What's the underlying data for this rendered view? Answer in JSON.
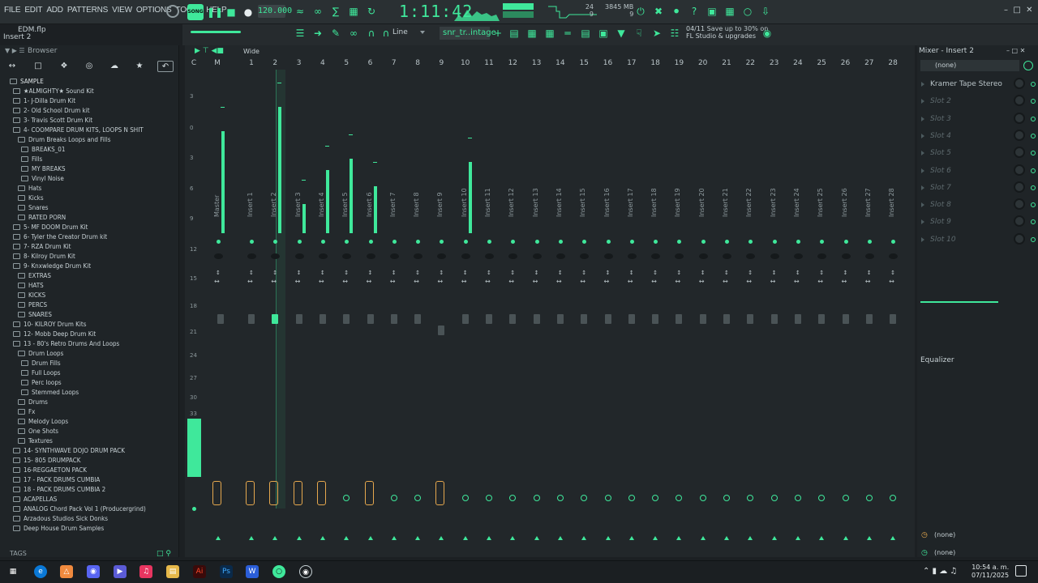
{
  "menu": [
    "FILE",
    "EDIT",
    "ADD",
    "PATTERNS",
    "VIEW",
    "OPTIONS",
    "TOOLS",
    "HELP"
  ],
  "project": {
    "file": "EDM.flp",
    "focus": "Insert 2"
  },
  "transport": {
    "mode": "SONG",
    "bpm": "120.000",
    "time": "1:11:42"
  },
  "memory": {
    "value": "3845 MB",
    "cpu": "9"
  },
  "cpu_meter": {
    "top": "24",
    "bottom": "9"
  },
  "toolbar": {
    "snap": "Line",
    "pattern": "snr_tr..intage",
    "mode": "Wide"
  },
  "promo": {
    "count": "04/11",
    "line1": "Save up to 30% on",
    "line2": "FL Studio & upgrades"
  },
  "browser": {
    "title": "Browser",
    "root": "SAMPLE",
    "items": [
      {
        "label": "★ALMIGHTY★ Sound Kit",
        "indent": 1
      },
      {
        "label": "1- J-Dilla Drum Kit",
        "indent": 1
      },
      {
        "label": "2- Old School Drum kit",
        "indent": 1
      },
      {
        "label": "3- Travis Scott Drum Kit",
        "indent": 1
      },
      {
        "label": "4- COOMPARE DRUM KITS, LOOPS N SHIT",
        "indent": 1
      },
      {
        "label": "Drum Breaks Loops and Fills",
        "indent": 2
      },
      {
        "label": "BREAKS_01",
        "indent": 3
      },
      {
        "label": "Fills",
        "indent": 3
      },
      {
        "label": "MY BREAKS",
        "indent": 3
      },
      {
        "label": "Vinyl Noise",
        "indent": 3
      },
      {
        "label": "Hats",
        "indent": 2
      },
      {
        "label": "Kicks",
        "indent": 2
      },
      {
        "label": "Snares",
        "indent": 2
      },
      {
        "label": "RATED PORN",
        "indent": 2
      },
      {
        "label": "5- MF DOOM Drum Kit",
        "indent": 1
      },
      {
        "label": "6- Tyler the Creator Drum kit",
        "indent": 1
      },
      {
        "label": "7- RZA Drum Kit",
        "indent": 1
      },
      {
        "label": "8- Kilroy Drum Kit",
        "indent": 1
      },
      {
        "label": "9- Knxwledge Drum Kit",
        "indent": 1
      },
      {
        "label": "EXTRAS",
        "indent": 2
      },
      {
        "label": "HATS",
        "indent": 2
      },
      {
        "label": "KICKS",
        "indent": 2
      },
      {
        "label": "PERCS",
        "indent": 2
      },
      {
        "label": "SNARES",
        "indent": 2
      },
      {
        "label": "10- KILROY Drum Kits",
        "indent": 1
      },
      {
        "label": "12- Mobb Deep Drum Kit",
        "indent": 1
      },
      {
        "label": "13 - 80's Retro Drums And Loops",
        "indent": 1
      },
      {
        "label": "Drum Loops",
        "indent": 2
      },
      {
        "label": "Drum Fills",
        "indent": 3
      },
      {
        "label": "Full Loops",
        "indent": 3
      },
      {
        "label": "Perc loops",
        "indent": 3
      },
      {
        "label": "Stemmed Loops",
        "indent": 3
      },
      {
        "label": "Drums",
        "indent": 2
      },
      {
        "label": "Fx",
        "indent": 2
      },
      {
        "label": "Melody Loops",
        "indent": 2
      },
      {
        "label": "One Shots",
        "indent": 2
      },
      {
        "label": "Textures",
        "indent": 2
      },
      {
        "label": "14- SYNTHWAVE DOJO DRUM PACK",
        "indent": 1
      },
      {
        "label": "15- 805 DRUMPACK",
        "indent": 1
      },
      {
        "label": "16-REGGAETON PACK",
        "indent": 1
      },
      {
        "label": "17 - PACK DRUMS CUMBIA",
        "indent": 1
      },
      {
        "label": "18 - PACK DRUMS CUMBIA 2",
        "indent": 1
      },
      {
        "label": "ACAPELLAS",
        "indent": 1
      },
      {
        "label": "ANALOG Chord Pack Vol 1 (Producergrind)",
        "indent": 1
      },
      {
        "label": "Arzadous Studios Sick Donks",
        "indent": 1
      },
      {
        "label": "Deep House Drum Samples",
        "indent": 1
      }
    ],
    "tags_label": "TAGS"
  },
  "mixer": {
    "column_numbers": [
      "C",
      "M",
      "1",
      "2",
      "3",
      "4",
      "5",
      "6",
      "7",
      "8",
      "9",
      "10",
      "11",
      "12",
      "13",
      "14",
      "15",
      "16",
      "17",
      "18",
      "19",
      "20",
      "21",
      "22",
      "23",
      "24",
      "25",
      "26",
      "27",
      "28"
    ],
    "tracks": [
      "Master",
      "Insert 1",
      "Insert 2",
      "Insert 3",
      "Insert 4",
      "Insert 5",
      "Insert 6",
      "Insert 7",
      "Insert 8",
      "Insert 9",
      "Insert 10",
      "Insert 11",
      "Insert 12",
      "Insert 13",
      "Insert 14",
      "Insert 15",
      "Insert 16",
      "Insert 17",
      "Insert 18",
      "Insert 19",
      "Insert 20",
      "Insert 21",
      "Insert 22",
      "Insert 23",
      "Insert 24",
      "Insert 25",
      "Insert 26",
      "Insert 27",
      "Insert 28"
    ],
    "selected_track": "Insert 2",
    "scale": [
      "3",
      "0",
      "3",
      "6",
      "9",
      "12",
      "15",
      "18",
      "21",
      "24",
      "27",
      "30",
      "33"
    ],
    "meter_levels": [
      0.63,
      0.0,
      0.78,
      0.18,
      0.39,
      0.46,
      0.29,
      0.0,
      0.0,
      0.0,
      0.44,
      0.0,
      0.0,
      0.0,
      0.0,
      0.0,
      0.0,
      0.0,
      0.0,
      0.0,
      0.0,
      0.0,
      0.0,
      0.0,
      0.0,
      0.0,
      0.0,
      0.0,
      0.0
    ],
    "fx_active": [
      true,
      true,
      true,
      true,
      true,
      false,
      true,
      false,
      false,
      true,
      false,
      false,
      false,
      false,
      false,
      false,
      false,
      false,
      false,
      false,
      false,
      false,
      false,
      false,
      false,
      false,
      false,
      false,
      false
    ]
  },
  "inspector": {
    "title": "Mixer - Insert 2",
    "input": "(none)",
    "slots": [
      "Kramer Tape Stereo",
      "Slot 2",
      "Slot 3",
      "Slot 4",
      "Slot 5",
      "Slot 6",
      "Slot 7",
      "Slot 8",
      "Slot 9",
      "Slot 10"
    ],
    "eq_label": "Equalizer",
    "output_top": "(none)",
    "output_bottom": "(none)"
  },
  "taskbar": {
    "time": "10:54 a. m.",
    "date": "07/11/2025"
  },
  "colors": {
    "accent": "#3fe89b",
    "fx_on": "#e6a84e",
    "bg": "#1c2023"
  }
}
